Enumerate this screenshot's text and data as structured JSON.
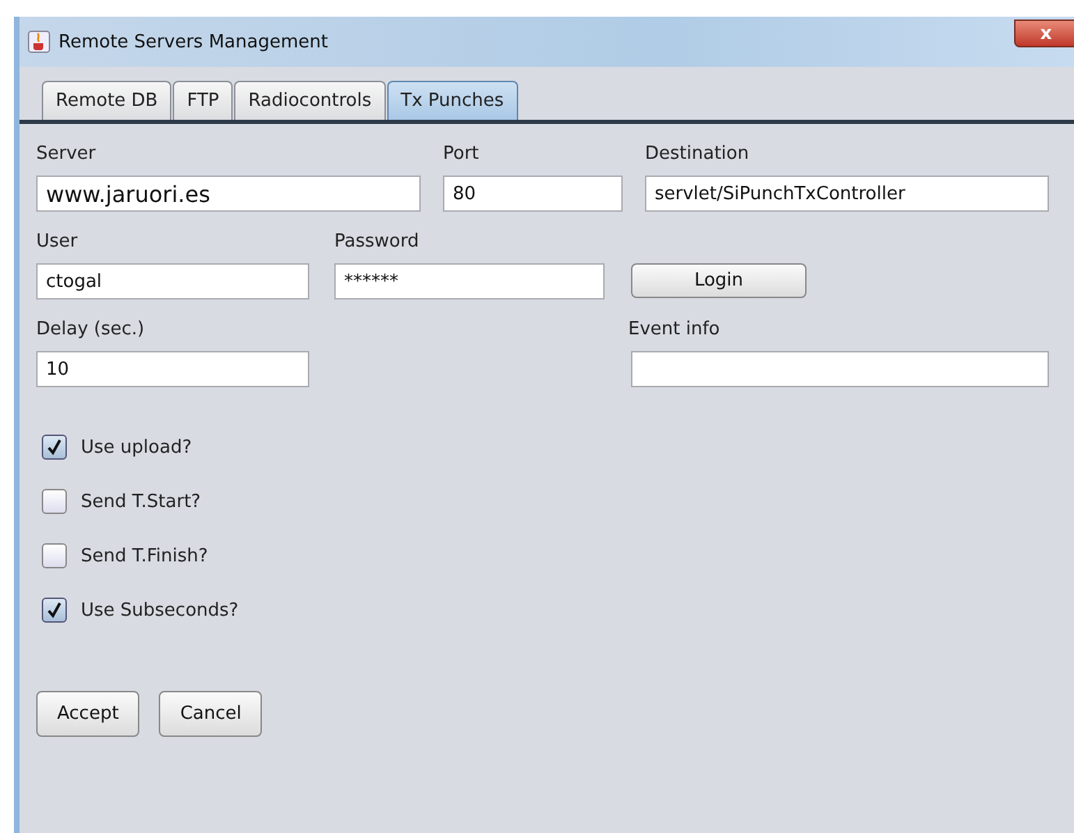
{
  "window": {
    "title": "Remote Servers Management",
    "close": "x"
  },
  "tabs": [
    {
      "label": "Remote DB",
      "selected": false
    },
    {
      "label": "FTP",
      "selected": false
    },
    {
      "label": "Radiocontrols",
      "selected": false
    },
    {
      "label": "Tx Punches",
      "selected": true
    }
  ],
  "fields": [
    {
      "label": "Server",
      "value": "www.jaruori.es"
    },
    {
      "label": "Port",
      "value": "80"
    },
    {
      "label": "Destination",
      "value": "servlet/SiPunchTxController"
    },
    {
      "label": "User",
      "value": "ctogal"
    },
    {
      "label": "Password",
      "value": "******"
    },
    {
      "label": "Delay (sec.)",
      "value": "10"
    },
    {
      "label": "Event info"
    }
  ],
  "login_button": "Login",
  "checkboxes": [
    {
      "label": "Use upload?",
      "checked": true
    },
    {
      "label": "Send T.Start?",
      "checked": false
    },
    {
      "label": "Send T.Finish?",
      "checked": false
    },
    {
      "label": "Use Subseconds?",
      "checked": true
    }
  ],
  "buttons": [
    "Accept",
    "Cancel"
  ]
}
